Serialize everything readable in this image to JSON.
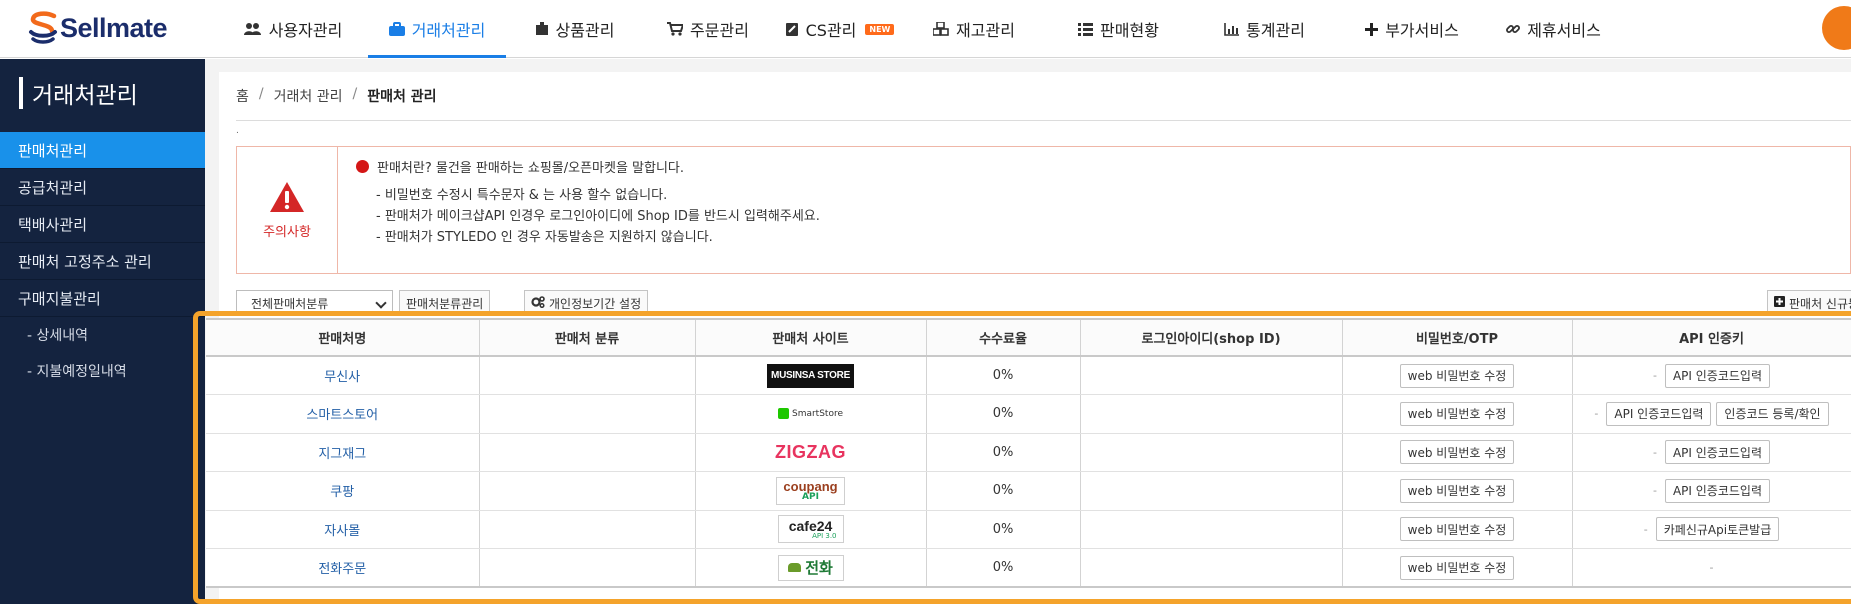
{
  "brand": {
    "name": "Sellmate"
  },
  "nav": [
    {
      "label": "사용자관리",
      "icon": "users-icon",
      "active": false,
      "badge": ""
    },
    {
      "label": "거래처관리",
      "icon": "briefcase-icon",
      "active": true,
      "badge": ""
    },
    {
      "label": "상품관리",
      "icon": "box-icon",
      "active": false,
      "badge": ""
    },
    {
      "label": "주문관리",
      "icon": "cart-icon",
      "active": false,
      "badge": ""
    },
    {
      "label": "CS관리",
      "icon": "edit-icon",
      "active": false,
      "badge": "NEW"
    },
    {
      "label": "재고관리",
      "icon": "cubes-icon",
      "active": false,
      "badge": ""
    },
    {
      "label": "판매현황",
      "icon": "list-icon",
      "active": false,
      "badge": ""
    },
    {
      "label": "통계관리",
      "icon": "bar-chart-icon",
      "active": false,
      "badge": ""
    },
    {
      "label": "부가서비스",
      "icon": "plus-icon",
      "active": false,
      "badge": ""
    },
    {
      "label": "제휴서비스",
      "icon": "link-icon",
      "active": false,
      "badge": ""
    }
  ],
  "sidebar": {
    "title": "거래처관리",
    "items": [
      {
        "label": "판매처관리",
        "active": true
      },
      {
        "label": "공급처관리",
        "active": false
      },
      {
        "label": "택배사관리",
        "active": false
      },
      {
        "label": "판매처 고정주소 관리",
        "active": false
      },
      {
        "label": "구매지불관리",
        "active": false
      }
    ],
    "subitems": [
      "- 상세내역",
      "- 지불예정일내역"
    ]
  },
  "breadcrumb": {
    "home": "홈",
    "section": "거래처 관리",
    "current": "판매처 관리",
    "sep": "/"
  },
  "notice": {
    "label": "주의사항",
    "headline": "판매처란? 물건을 판매하는 쇼핑몰/오픈마켓을 말합니다.",
    "lines": [
      "- 비밀번호 수정시 특수문자 & 는 사용 할수 없습니다.",
      "- 판매처가 메이크샵API 인경우 로그인아이디에 Shop ID를 반드시 입력해주세요.",
      "- 판매처가 STYLEDO 인 경우 자동발송은 지원하지 않습니다."
    ],
    "colors": {
      "border": "#efb7a8",
      "alert": "#d42727"
    }
  },
  "toolbar": {
    "filter_value": "전체판매처분류",
    "category_btn": "판매처분류관리",
    "privacy_btn": "개인정보기간 설정",
    "new_btn": "판매처 신규등"
  },
  "table": {
    "headers": [
      "판매처명",
      "판매처 분류",
      "판매처 사이트",
      "수수료율",
      "로그인아이디(shop ID)",
      "비밀번호/OTP",
      "API 인증키"
    ],
    "rows": [
      {
        "name": "무신사",
        "category": "",
        "site_logo": "MUSINSA STORE",
        "site_logo_sub": "",
        "rate": "0%",
        "login_id": "",
        "pw_btn": "web 비밀번호 수정",
        "api": [
          "API 인증코드입력"
        ],
        "api_dash": "-"
      },
      {
        "name": "스마트스토어",
        "category": "",
        "site_logo": "SmartStore",
        "site_logo_sub": "",
        "rate": "0%",
        "login_id": "",
        "pw_btn": "web 비밀번호 수정",
        "api": [
          "API 인증코드입력",
          "인증코드 등록/확인"
        ],
        "api_dash": "-"
      },
      {
        "name": "지그재그",
        "category": "",
        "site_logo": "ZIGZAG",
        "site_logo_sub": "",
        "rate": "0%",
        "login_id": "",
        "pw_btn": "web 비밀번호 수정",
        "api": [
          "API 인증코드입력"
        ],
        "api_dash": "-"
      },
      {
        "name": "쿠팡",
        "category": "",
        "site_logo": "coupang",
        "site_logo_sub": "API",
        "rate": "0%",
        "login_id": "",
        "pw_btn": "web 비밀번호 수정",
        "api": [
          "API 인증코드입력"
        ],
        "api_dash": "-"
      },
      {
        "name": "자사몰",
        "category": "",
        "site_logo": "cafe24",
        "site_logo_sub": "API 3.0",
        "rate": "0%",
        "login_id": "",
        "pw_btn": "web 비밀번호 수정",
        "api": [
          "카페신규Api토큰발급"
        ],
        "api_dash": "-"
      },
      {
        "name": "전화주문",
        "category": "",
        "site_logo": "전화",
        "site_logo_sub": "",
        "rate": "0%",
        "login_id": "",
        "pw_btn": "web 비밀번호 수정",
        "api": [],
        "api_dash": "-"
      }
    ]
  },
  "colors": {
    "accent": "#1a7ee6",
    "sidebar_bg": "#14233f",
    "sidebar_active": "#1991ea",
    "highlight_frame": "#f4a32b",
    "link": "#2460a7"
  }
}
